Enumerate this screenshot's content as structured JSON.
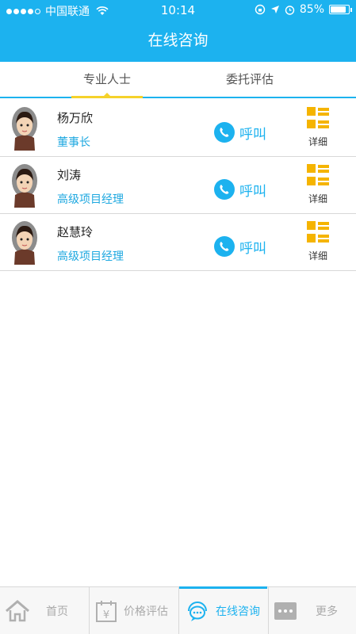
{
  "status_bar": {
    "carrier": "中国联通",
    "time": "10:14",
    "battery_text": "85%",
    "battery_level": 0.85
  },
  "header": {
    "title": "在线咨询"
  },
  "tabs": [
    {
      "label": "专业人士",
      "active": true
    },
    {
      "label": "委托评估",
      "active": false
    }
  ],
  "list": [
    {
      "name": "杨万欣",
      "title": "董事长",
      "call_label": "呼叫",
      "detail_label": "详细"
    },
    {
      "name": "刘涛",
      "title": "高级项目经理",
      "call_label": "呼叫",
      "detail_label": "详细"
    },
    {
      "name": "赵慧玲",
      "title": "高级项目经理",
      "call_label": "呼叫",
      "detail_label": "详细"
    }
  ],
  "bottom_nav": [
    {
      "label": "首页",
      "icon": "home-icon"
    },
    {
      "label": "价格评估",
      "icon": "calendar-yen-icon"
    },
    {
      "label": "在线咨询",
      "icon": "chat-headset-icon",
      "active": true
    },
    {
      "label": "更多",
      "icon": "more-icon"
    }
  ],
  "colors": {
    "primary": "#1cb2ef",
    "accent": "#f5b400",
    "tab_indicator": "#f5d22b"
  }
}
